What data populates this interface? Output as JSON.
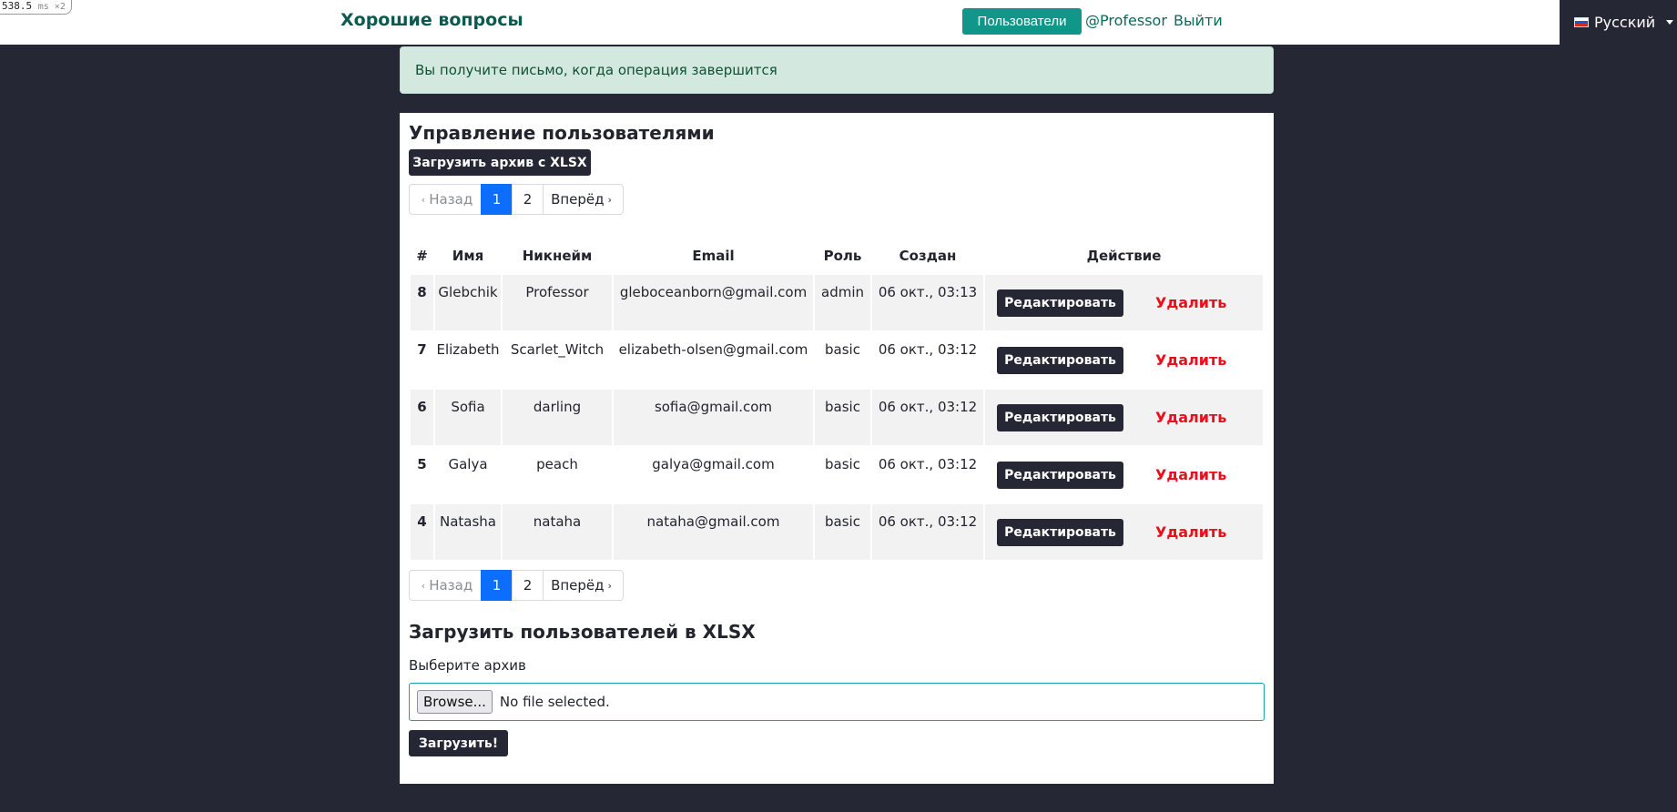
{
  "perf": {
    "value": "538.5",
    "unit": "ms ×2"
  },
  "header": {
    "brand": "Хорошие вопросы",
    "users_button": "Пользователи",
    "profile_link": "@Professor",
    "logout_link": "Выйти",
    "language": "Русский"
  },
  "alert": {
    "text": "Вы получите письмо, когда операция завершится"
  },
  "main": {
    "title": "Управление пользователями",
    "download_button": "Загрузить архив с XLSX",
    "pagination": {
      "prev": "Назад",
      "pages": [
        "1",
        "2"
      ],
      "current": "1",
      "next": "Вперёд",
      "prev_chevron": "‹",
      "next_chevron": "›"
    },
    "table": {
      "headers": [
        "#",
        "Имя",
        "Никнейм",
        "Email",
        "Роль",
        "Создан",
        "Действие"
      ],
      "edit_label": "Редактировать",
      "delete_label": "Удалить",
      "rows": [
        {
          "id": "8",
          "name": "Glebchik",
          "nickname": "Professor",
          "email": "gleboceanborn@gmail.com",
          "role": "admin",
          "created": "06 окт., 03:13"
        },
        {
          "id": "7",
          "name": "Elizabeth",
          "nickname": "Scarlet_Witch",
          "email": "elizabeth-olsen@gmail.com",
          "role": "basic",
          "created": "06 окт., 03:12"
        },
        {
          "id": "6",
          "name": "Sofia",
          "nickname": "darling",
          "email": "sofia@gmail.com",
          "role": "basic",
          "created": "06 окт., 03:12"
        },
        {
          "id": "5",
          "name": "Galya",
          "nickname": "peach",
          "email": "galya@gmail.com",
          "role": "basic",
          "created": "06 окт., 03:12"
        },
        {
          "id": "4",
          "name": "Natasha",
          "nickname": "nataha",
          "email": "nataha@gmail.com",
          "role": "basic",
          "created": "06 окт., 03:12"
        }
      ]
    }
  },
  "upload": {
    "title": "Загрузить пользователей в XLSX",
    "label": "Выберите архив",
    "browse_button": "Browse...",
    "file_status": "No file selected.",
    "submit_button": "Загрузить!"
  },
  "colors": {
    "accent": "#11968a",
    "brand": "#0a5a4f",
    "dark": "#262734",
    "danger": "#e8101a",
    "page_active": "#0d6efd"
  }
}
